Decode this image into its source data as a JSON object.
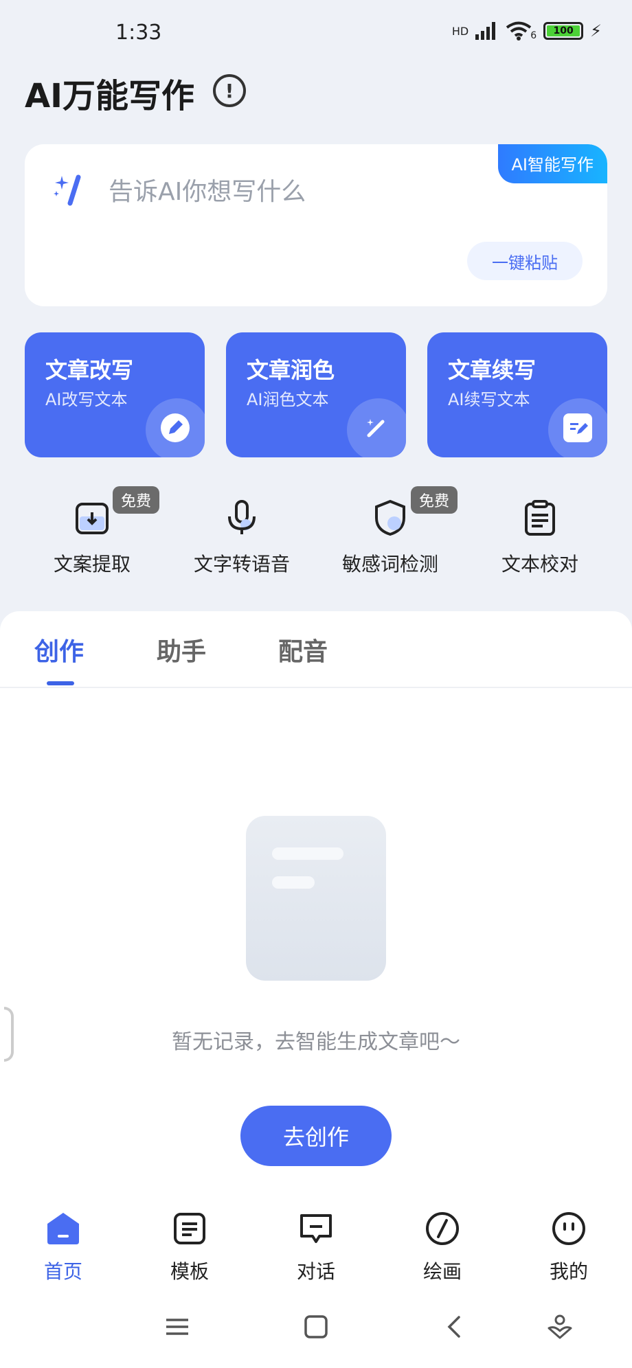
{
  "status_bar": {
    "time": "1:33",
    "network": "HD",
    "wifi": "6",
    "battery": "100"
  },
  "header": {
    "title": "AI万能写作",
    "info_icon": "info-circle-icon"
  },
  "input_card": {
    "badge": "AI智能写作",
    "placeholder": "告诉AI你想写什么",
    "paste_label": "一键粘贴"
  },
  "features": [
    {
      "title": "文章改写",
      "subtitle": "AI改写文本",
      "icon": "pen-edit-icon"
    },
    {
      "title": "文章润色",
      "subtitle": "AI润色文本",
      "icon": "magic-wand-icon"
    },
    {
      "title": "文章续写",
      "subtitle": "AI续写文本",
      "icon": "note-edit-icon"
    }
  ],
  "tools": [
    {
      "label": "文案提取",
      "icon": "download-box-icon",
      "badge": "免费"
    },
    {
      "label": "文字转语音",
      "icon": "microphone-icon",
      "badge": ""
    },
    {
      "label": "敏感词检测",
      "icon": "shield-icon",
      "badge": "免费"
    },
    {
      "label": "文本校对",
      "icon": "clipboard-icon",
      "badge": ""
    }
  ],
  "tabs": [
    {
      "label": "创作",
      "active": true
    },
    {
      "label": "助手",
      "active": false
    },
    {
      "label": "配音",
      "active": false
    }
  ],
  "empty_state": {
    "text": "暂无记录，去智能生成文章吧～",
    "button": "去创作"
  },
  "bottom_nav": [
    {
      "label": "首页",
      "icon": "home-icon",
      "active": true
    },
    {
      "label": "模板",
      "icon": "template-icon",
      "active": false
    },
    {
      "label": "对话",
      "icon": "chat-icon",
      "active": false
    },
    {
      "label": "绘画",
      "icon": "paint-icon",
      "active": false
    },
    {
      "label": "我的",
      "icon": "profile-icon",
      "active": false
    }
  ],
  "colors": {
    "accent": "#4a6df2",
    "background": "#eef1f7",
    "badge_gradient_start": "#2f7bff",
    "badge_gradient_end": "#18b4ff"
  }
}
